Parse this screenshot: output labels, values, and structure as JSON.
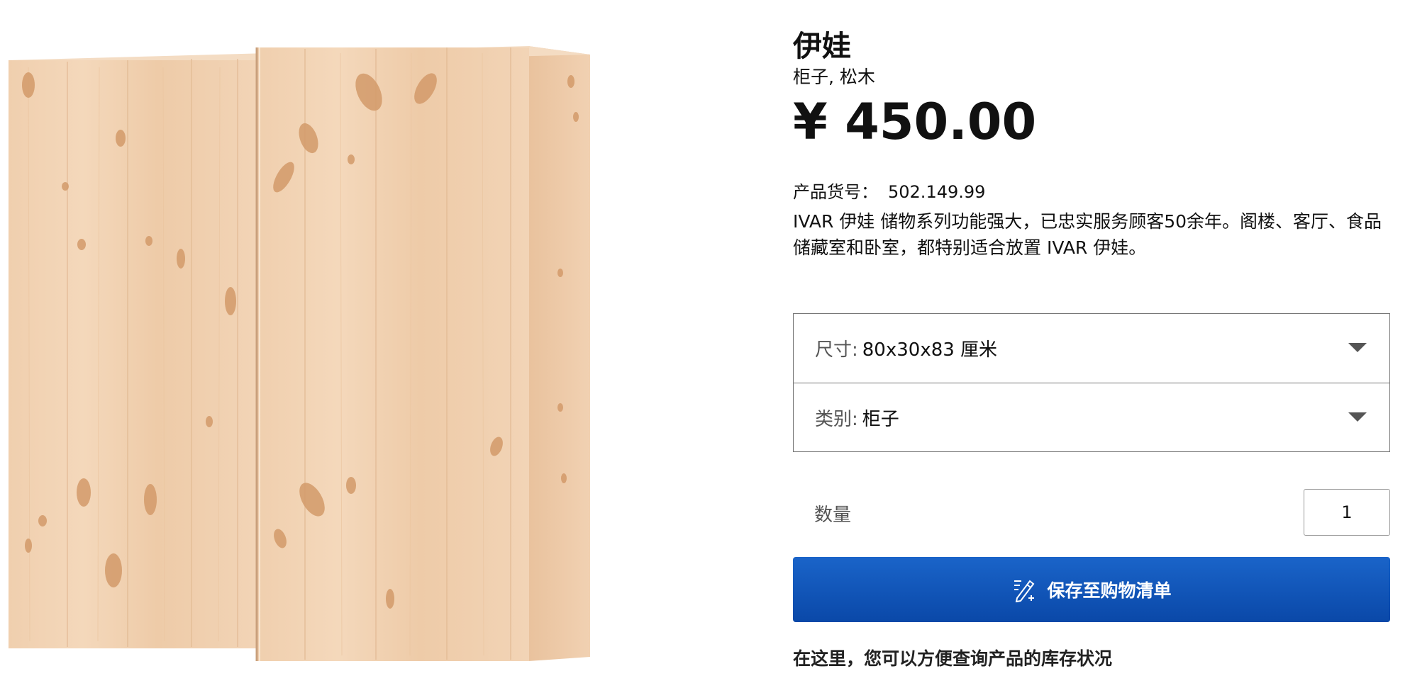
{
  "product": {
    "name": "伊娃",
    "subtitle": "柜子, 松木",
    "price": "¥ 450.00",
    "article_label": "产品货号：",
    "article_number": "502.149.99",
    "description": "IVAR 伊娃 储物系列功能强大，已忠实服务顾客50余年。阁楼、客厅、食品储藏室和卧室，都特别适合放置 IVAR 伊娃。",
    "image_icon": "pine-cabinet-image"
  },
  "selectors": {
    "size": {
      "label": "尺寸:",
      "value": "80x30x83 厘米"
    },
    "type": {
      "label": "类别:",
      "value": "柜子"
    }
  },
  "quantity": {
    "label": "数量",
    "value": "1"
  },
  "save_button": {
    "label": "保存至购物清单",
    "icon": "pencil-list-add-icon",
    "color": "#0e58c2"
  },
  "stock_note": "在这里，您可以方便查询产品的库存状况"
}
